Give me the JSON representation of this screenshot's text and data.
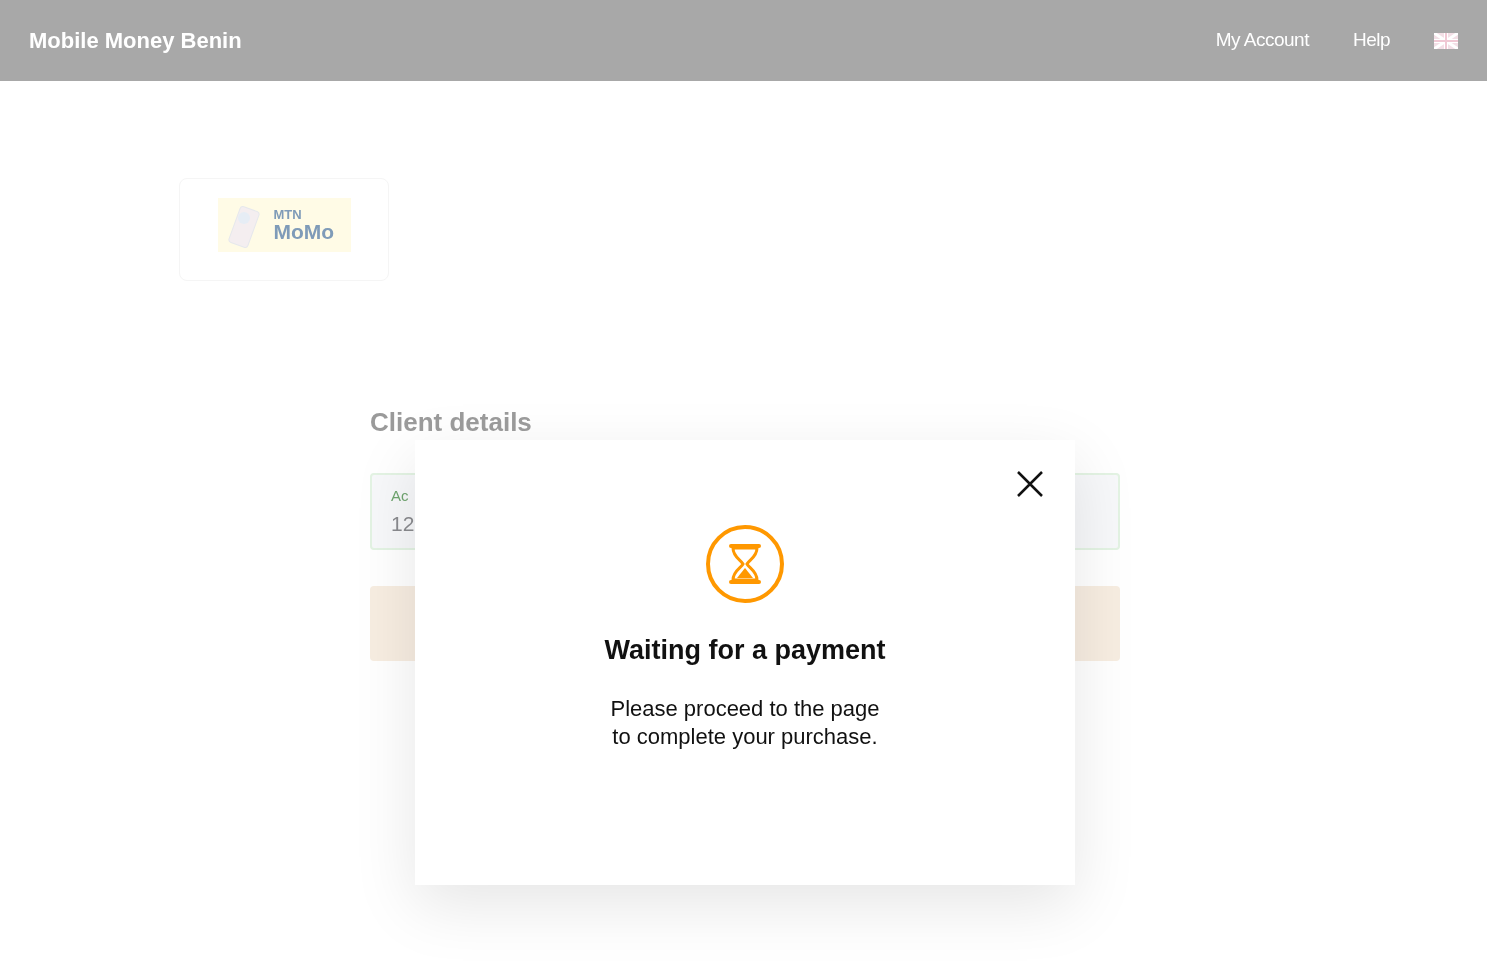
{
  "header": {
    "title": "Mobile Money Benin",
    "links": [
      "My Account",
      "Help"
    ]
  },
  "provider": {
    "logo_line1": "MTN",
    "logo_line2": "MoMo"
  },
  "client_details": {
    "title": "Client details",
    "field_label": "Ac",
    "field_value": "12"
  },
  "modal": {
    "title": "Waiting for a payment",
    "message_lines": [
      "Please proceed to the page",
      "to complete your purchase."
    ]
  }
}
